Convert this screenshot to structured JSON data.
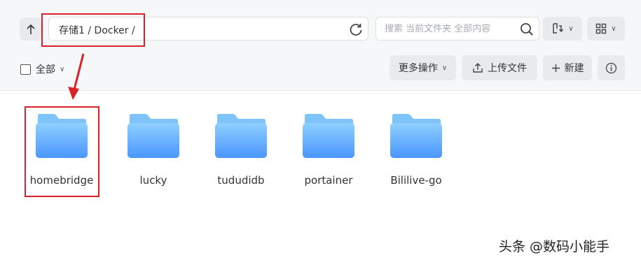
{
  "toolbar": {
    "path": "存储1 / Docker /",
    "search_placeholder": "搜索 当前文件夹 全部内容",
    "select_all_label": "全部",
    "more_actions_label": "更多操作",
    "upload_label": "上传文件",
    "new_label": "新建"
  },
  "folders": [
    {
      "name": "homebridge"
    },
    {
      "name": "lucky"
    },
    {
      "name": "tududidb"
    },
    {
      "name": "portainer"
    },
    {
      "name": "Bililive-go"
    }
  ],
  "watermark": "头条 @数码小能手",
  "colors": {
    "annotation": "#d8232a",
    "folder_top": "#8fd0ff",
    "folder_bottom": "#4a96ff"
  },
  "icons": [
    "up-arrow-icon",
    "refresh-icon",
    "search-icon",
    "sort-icon",
    "grid-view-icon",
    "upload-icon",
    "plus-icon",
    "info-icon",
    "folder-icon"
  ]
}
